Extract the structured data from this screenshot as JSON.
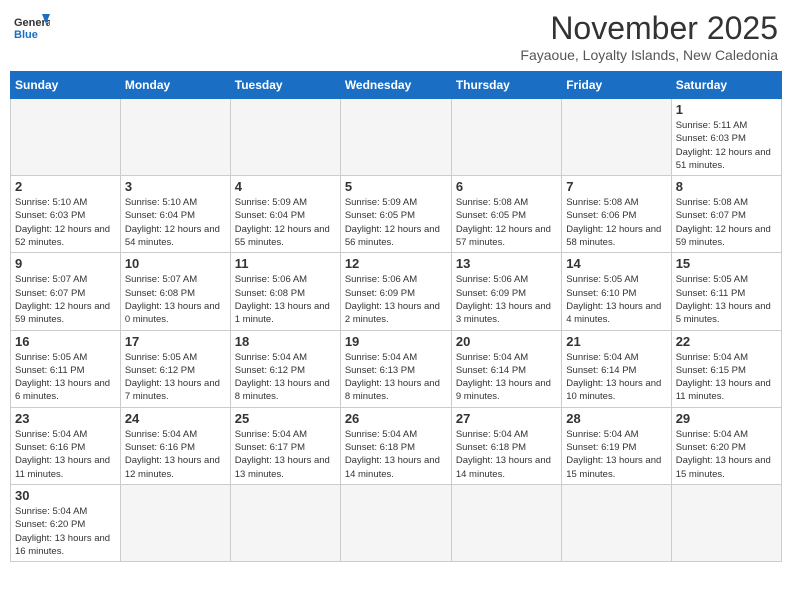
{
  "header": {
    "logo_general": "General",
    "logo_blue": "Blue",
    "month_title": "November 2025",
    "subtitle": "Fayaoue, Loyalty Islands, New Caledonia"
  },
  "weekdays": [
    "Sunday",
    "Monday",
    "Tuesday",
    "Wednesday",
    "Thursday",
    "Friday",
    "Saturday"
  ],
  "weeks": [
    [
      {
        "num": "",
        "info": ""
      },
      {
        "num": "",
        "info": ""
      },
      {
        "num": "",
        "info": ""
      },
      {
        "num": "",
        "info": ""
      },
      {
        "num": "",
        "info": ""
      },
      {
        "num": "",
        "info": ""
      },
      {
        "num": "1",
        "info": "Sunrise: 5:11 AM\nSunset: 6:03 PM\nDaylight: 12 hours and 51 minutes."
      }
    ],
    [
      {
        "num": "2",
        "info": "Sunrise: 5:10 AM\nSunset: 6:03 PM\nDaylight: 12 hours and 52 minutes."
      },
      {
        "num": "3",
        "info": "Sunrise: 5:10 AM\nSunset: 6:04 PM\nDaylight: 12 hours and 54 minutes."
      },
      {
        "num": "4",
        "info": "Sunrise: 5:09 AM\nSunset: 6:04 PM\nDaylight: 12 hours and 55 minutes."
      },
      {
        "num": "5",
        "info": "Sunrise: 5:09 AM\nSunset: 6:05 PM\nDaylight: 12 hours and 56 minutes."
      },
      {
        "num": "6",
        "info": "Sunrise: 5:08 AM\nSunset: 6:05 PM\nDaylight: 12 hours and 57 minutes."
      },
      {
        "num": "7",
        "info": "Sunrise: 5:08 AM\nSunset: 6:06 PM\nDaylight: 12 hours and 58 minutes."
      },
      {
        "num": "8",
        "info": "Sunrise: 5:08 AM\nSunset: 6:07 PM\nDaylight: 12 hours and 59 minutes."
      }
    ],
    [
      {
        "num": "9",
        "info": "Sunrise: 5:07 AM\nSunset: 6:07 PM\nDaylight: 12 hours and 59 minutes."
      },
      {
        "num": "10",
        "info": "Sunrise: 5:07 AM\nSunset: 6:08 PM\nDaylight: 13 hours and 0 minutes."
      },
      {
        "num": "11",
        "info": "Sunrise: 5:06 AM\nSunset: 6:08 PM\nDaylight: 13 hours and 1 minute."
      },
      {
        "num": "12",
        "info": "Sunrise: 5:06 AM\nSunset: 6:09 PM\nDaylight: 13 hours and 2 minutes."
      },
      {
        "num": "13",
        "info": "Sunrise: 5:06 AM\nSunset: 6:09 PM\nDaylight: 13 hours and 3 minutes."
      },
      {
        "num": "14",
        "info": "Sunrise: 5:05 AM\nSunset: 6:10 PM\nDaylight: 13 hours and 4 minutes."
      },
      {
        "num": "15",
        "info": "Sunrise: 5:05 AM\nSunset: 6:11 PM\nDaylight: 13 hours and 5 minutes."
      }
    ],
    [
      {
        "num": "16",
        "info": "Sunrise: 5:05 AM\nSunset: 6:11 PM\nDaylight: 13 hours and 6 minutes."
      },
      {
        "num": "17",
        "info": "Sunrise: 5:05 AM\nSunset: 6:12 PM\nDaylight: 13 hours and 7 minutes."
      },
      {
        "num": "18",
        "info": "Sunrise: 5:04 AM\nSunset: 6:12 PM\nDaylight: 13 hours and 8 minutes."
      },
      {
        "num": "19",
        "info": "Sunrise: 5:04 AM\nSunset: 6:13 PM\nDaylight: 13 hours and 8 minutes."
      },
      {
        "num": "20",
        "info": "Sunrise: 5:04 AM\nSunset: 6:14 PM\nDaylight: 13 hours and 9 minutes."
      },
      {
        "num": "21",
        "info": "Sunrise: 5:04 AM\nSunset: 6:14 PM\nDaylight: 13 hours and 10 minutes."
      },
      {
        "num": "22",
        "info": "Sunrise: 5:04 AM\nSunset: 6:15 PM\nDaylight: 13 hours and 11 minutes."
      }
    ],
    [
      {
        "num": "23",
        "info": "Sunrise: 5:04 AM\nSunset: 6:16 PM\nDaylight: 13 hours and 11 minutes."
      },
      {
        "num": "24",
        "info": "Sunrise: 5:04 AM\nSunset: 6:16 PM\nDaylight: 13 hours and 12 minutes."
      },
      {
        "num": "25",
        "info": "Sunrise: 5:04 AM\nSunset: 6:17 PM\nDaylight: 13 hours and 13 minutes."
      },
      {
        "num": "26",
        "info": "Sunrise: 5:04 AM\nSunset: 6:18 PM\nDaylight: 13 hours and 14 minutes."
      },
      {
        "num": "27",
        "info": "Sunrise: 5:04 AM\nSunset: 6:18 PM\nDaylight: 13 hours and 14 minutes."
      },
      {
        "num": "28",
        "info": "Sunrise: 5:04 AM\nSunset: 6:19 PM\nDaylight: 13 hours and 15 minutes."
      },
      {
        "num": "29",
        "info": "Sunrise: 5:04 AM\nSunset: 6:20 PM\nDaylight: 13 hours and 15 minutes."
      }
    ],
    [
      {
        "num": "30",
        "info": "Sunrise: 5:04 AM\nSunset: 6:20 PM\nDaylight: 13 hours and 16 minutes."
      },
      {
        "num": "",
        "info": ""
      },
      {
        "num": "",
        "info": ""
      },
      {
        "num": "",
        "info": ""
      },
      {
        "num": "",
        "info": ""
      },
      {
        "num": "",
        "info": ""
      },
      {
        "num": "",
        "info": ""
      }
    ]
  ]
}
